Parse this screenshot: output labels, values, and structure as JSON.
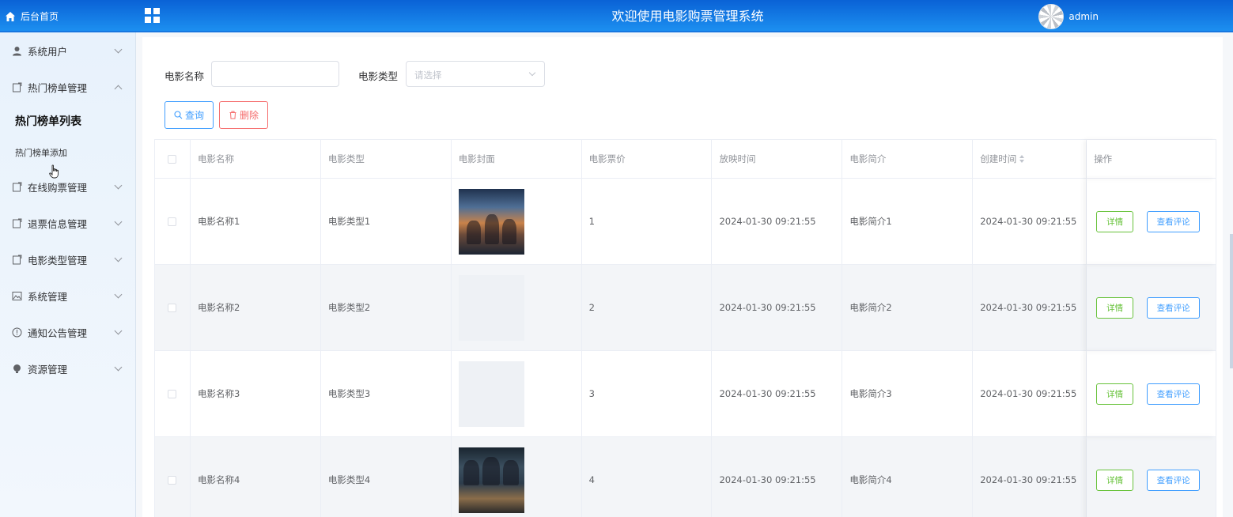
{
  "app": {
    "title": "欢迎使用电影购票管理系统",
    "brand_label": "后台首页",
    "username": "admin"
  },
  "sidebar": {
    "items": [
      {
        "label": "系统用户",
        "icon": "user-icon",
        "expanded": false
      },
      {
        "label": "热门榜单管理",
        "icon": "document-icon",
        "expanded": true
      },
      {
        "label": "在线购票管理",
        "icon": "document-icon",
        "expanded": false
      },
      {
        "label": "退票信息管理",
        "icon": "document-icon",
        "expanded": false
      },
      {
        "label": "电影类型管理",
        "icon": "document-icon",
        "expanded": false
      },
      {
        "label": "系统管理",
        "icon": "picture-icon",
        "expanded": false
      },
      {
        "label": "通知公告管理",
        "icon": "info-circle-icon",
        "expanded": false
      },
      {
        "label": "资源管理",
        "icon": "bulb-icon",
        "expanded": false
      }
    ],
    "submenu": {
      "active": "热门榜单列表",
      "other": "热门榜单添加"
    }
  },
  "search": {
    "name_label": "电影名称",
    "name_value": "",
    "type_label": "电影类型",
    "type_placeholder": "请选择",
    "query_button": "查询",
    "delete_button": "删除"
  },
  "table": {
    "columns": [
      "电影名称",
      "电影类型",
      "电影封面",
      "电影票价",
      "放映时间",
      "电影简介",
      "创建时间",
      "操作"
    ],
    "rows": [
      {
        "name": "电影名称1",
        "type": "电影类型1",
        "cover": "poster-image",
        "price": "1",
        "show_time": "2024-01-30 09:21:55",
        "intro": "电影简介1",
        "created": "2024-01-30 09:21:55"
      },
      {
        "name": "电影名称2",
        "type": "电影类型2",
        "cover": "empty",
        "price": "2",
        "show_time": "2024-01-30 09:21:55",
        "intro": "电影简介2",
        "created": "2024-01-30 09:21:55"
      },
      {
        "name": "电影名称3",
        "type": "电影类型3",
        "cover": "empty",
        "price": "3",
        "show_time": "2024-01-30 09:21:55",
        "intro": "电影简介3",
        "created": "2024-01-30 09:21:55"
      },
      {
        "name": "电影名称4",
        "type": "电影类型4",
        "cover": "poster-image",
        "price": "4",
        "show_time": "2024-01-30 09:21:55",
        "intro": "电影简介4",
        "created": "2024-01-30 09:21:55"
      }
    ],
    "actions": {
      "detail": "详情",
      "comments": "查看评论"
    }
  },
  "colors": {
    "topbar": "#1c8ff0",
    "primary": "#409eff",
    "success": "#67c23a",
    "danger": "#f56c6c"
  }
}
